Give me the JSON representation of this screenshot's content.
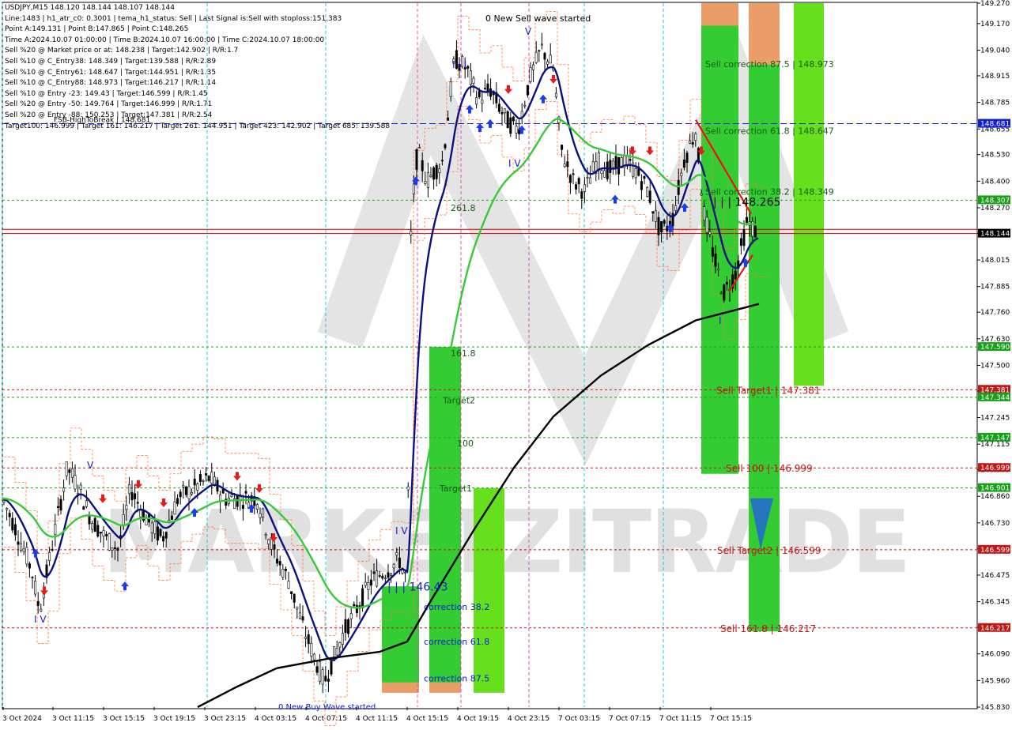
{
  "info_lines": [
    "USDJPY,M15  148.120 148.144 148.107 148.144",
    "Line:1483 | h1_atr_c0: 0.3001 | tema_h1_status: Sell | Last Signal is:Sell with stoploss:151.383",
    "Point A:149.131 | Point B:147.865 | Point C:148.265",
    "Time A:2024.10.07 01:00:00 | Time B:2024.10.07 16:00:00 | Time C:2024.10.07 18:00:00",
    "Sell %20 @ Market price or at: 148.238 | Target:142.902 | R/R:1.7",
    "Sell %10 @ C_Entry38: 148.349 | Target:139.588 | R/R:2.89",
    "Sell %10 @ C_Entry61: 148.647 | Target:144.951 | R/R:1.35",
    "Sell %10 @ C_Entry88: 148.973 | Target:146.217 | R/R:1.14",
    "Sell %10 @ Entry -23: 149.43 | Target:146.599 | R/R:1.45",
    "Sell %20 @ Entry -50: 149.764 | Target:146.999 | R/R:1.71",
    "Sell %20 @ Entry -88: 150.253 | Target:147.381 | R/R:2.54",
    "Target100: 146.999 | Target 161: 146.217 | Target 261: 144.951 | Target 423: 142.902 | Target 685: 139.588"
  ],
  "colors": {
    "candle": "#000000",
    "tema": "#0b1280",
    "ema_green": "#38c938",
    "ema_black": "#000000",
    "envelope": "#ff7a3a",
    "zone_green": "#33cc33",
    "zone_lime": "#66e01c",
    "zone_orange": "#eb9d68",
    "red_line": "#d40000",
    "blue_dash": "#1020d0",
    "green_dash": "#18a018",
    "red_dash": "#c01818",
    "cyan_vline": "#20c8d8",
    "magenta_vline": "#e050b0",
    "watermark": "#c8c8c8"
  },
  "chart_data": {
    "type": "candlestick",
    "symbol": "USDJPY",
    "timeframe": "M15",
    "ohlc": {
      "open": 148.12,
      "high": 148.144,
      "low": 148.107,
      "close": 148.144
    },
    "y_range": [
      145.83,
      149.27
    ],
    "y_ticks": [
      "149.270",
      "149.170",
      "149.040",
      "148.915",
      "148.785",
      "148.655",
      "148.530",
      "148.400",
      "148.270",
      "148.145",
      "148.015",
      "147.885",
      "147.760",
      "147.630",
      "147.500",
      "147.375",
      "147.245",
      "147.115",
      "146.990",
      "146.860",
      "146.730",
      "146.605",
      "146.475",
      "146.345",
      "146.220",
      "146.090",
      "145.960",
      "145.830"
    ],
    "x_ticks": [
      "3 Oct 2024",
      "3 Oct 11:15",
      "3 Oct 15:15",
      "3 Oct 19:15",
      "3 Oct 23:15",
      "4 Oct 03:15",
      "4 Oct 07:15",
      "4 Oct 11:15",
      "4 Oct 15:15",
      "4 Oct 19:15",
      "4 Oct 23:15",
      "7 Oct 03:15",
      "7 Oct 07:15",
      "7 Oct 11:15",
      "7 Oct 15:15"
    ],
    "price_line": {
      "value": 148.144,
      "label": "148.144"
    },
    "horizontal_levels": [
      {
        "value": 148.681,
        "label": "148.681",
        "kind": "blue-dash",
        "text": "FSB-HighToBreak | 148.681"
      },
      {
        "value": 148.307,
        "label": "148.307",
        "kind": "green-dash"
      },
      {
        "value": 148.165,
        "label": "",
        "kind": "red-solid"
      },
      {
        "value": 147.59,
        "label": "147.590",
        "kind": "green-dash"
      },
      {
        "value": 147.381,
        "label": "147.381",
        "kind": "red-dash"
      },
      {
        "value": 147.344,
        "label": "147.344",
        "kind": "green-dash"
      },
      {
        "value": 147.147,
        "label": "147.147",
        "kind": "green-dash"
      },
      {
        "value": 146.999,
        "label": "146.999",
        "kind": "red-dash"
      },
      {
        "value": 146.901,
        "label": "146.901",
        "kind": "green-dash"
      },
      {
        "value": 146.599,
        "label": "146.599",
        "kind": "red-dash"
      },
      {
        "value": 146.217,
        "label": "146.217",
        "kind": "red-dash"
      }
    ],
    "annotations": [
      {
        "text": "0 New Sell wave started",
        "x": "4 Oct 22:00",
        "y": 149.22
      },
      {
        "text": "0 New Buy Wave started",
        "x": "4 Oct 08:00",
        "y": 145.83
      },
      {
        "text": "Sell correction 87.5 | 148.973",
        "y": 148.973
      },
      {
        "text": "Sell correction 61.8 | 148.647",
        "y": 148.647
      },
      {
        "text": "Sell correction 38.2 | 148.349",
        "y": 148.349
      },
      {
        "text": "Sell Target1 | 147.381",
        "y": 147.381
      },
      {
        "text": "Sell 100 | 146.999",
        "y": 146.999
      },
      {
        "text": "Sell Target2 | 146.599",
        "y": 146.599
      },
      {
        "text": "Sell 161.8 | 146.217",
        "y": 146.217
      },
      {
        "text": "| | | 148.265",
        "y": 148.265
      },
      {
        "text": "| | | 146.43",
        "y": 146.43
      },
      {
        "text": "261.8",
        "y": 148.27
      },
      {
        "text": "161.8",
        "y": 147.56
      },
      {
        "text": "Target2",
        "y": 147.33
      },
      {
        "text": "100",
        "y": 147.12
      },
      {
        "text": "Target1",
        "y": 146.9
      },
      {
        "text": "correction 38.2",
        "y": 146.32
      },
      {
        "text": "correction 61.8",
        "y": 146.15
      },
      {
        "text": "correction 87.5",
        "y": 145.97
      }
    ],
    "wave_labels": [
      "I V",
      "V",
      "I I I",
      "I V",
      "V",
      "I V",
      "I"
    ],
    "watermark": "MARKETZITRADE",
    "series": [
      {
        "name": "TEMA",
        "color": "#0b1280"
      },
      {
        "name": "EMA",
        "color": "#38c938"
      },
      {
        "name": "EMA slow",
        "color": "#000000"
      }
    ]
  }
}
